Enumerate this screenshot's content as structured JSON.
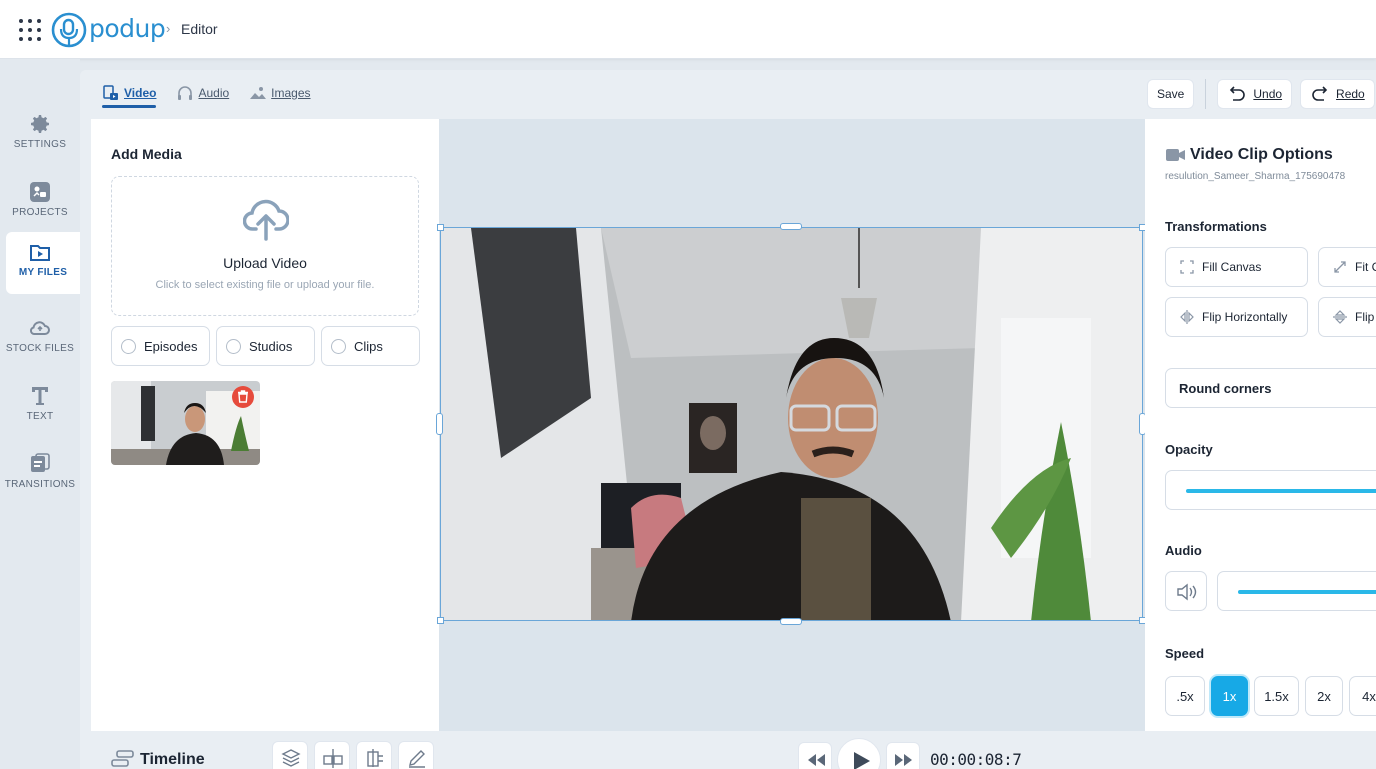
{
  "header": {
    "brand": "podup",
    "breadcrumb_sep": "›",
    "breadcrumb": "Editor"
  },
  "sidebar": {
    "items": [
      {
        "label": "SETTINGS",
        "icon": "gear-icon"
      },
      {
        "label": "PROJECTS",
        "icon": "projects-icon"
      },
      {
        "label": "MY FILES",
        "icon": "my-files-icon",
        "active": true
      },
      {
        "label": "STOCK FILES",
        "icon": "cloud-icon"
      },
      {
        "label": "TEXT",
        "icon": "text-icon"
      },
      {
        "label": "TRANSITIONS",
        "icon": "transitions-icon"
      }
    ]
  },
  "tabs": [
    {
      "label": "Video",
      "icon": "video-icon",
      "active": true
    },
    {
      "label": "Audio",
      "icon": "headphones-icon"
    },
    {
      "label": "Images",
      "icon": "image-icon"
    }
  ],
  "toolbar": {
    "save": "Save",
    "undo": "Undo",
    "redo": "Redo"
  },
  "media": {
    "title": "Add Media",
    "upload_title": "Upload Video",
    "upload_hint": "Click to select existing file or upload your file.",
    "filters": [
      "Episodes",
      "Studios",
      "Clips"
    ]
  },
  "options": {
    "title": "Video Clip Options",
    "filename": "resulution_Sameer_Sharma_175690478",
    "transformations_label": "Transformations",
    "fill_canvas": "Fill Canvas",
    "fit": "Fit C",
    "flip_h": "Flip Horizontally",
    "flip_v": "Flip",
    "round_corners": "Round corners",
    "opacity_label": "Opacity",
    "audio_label": "Audio",
    "speed_label": "Speed",
    "speeds": [
      ".5x",
      "1x",
      "1.5x",
      "2x",
      "4x"
    ],
    "active_speed": "1x"
  },
  "timeline": {
    "title": "Timeline",
    "time": "00:00:08:7"
  },
  "colors": {
    "accent": "#17a9e6",
    "brand": "#2a8fd0",
    "delete": "#e64b3c"
  }
}
